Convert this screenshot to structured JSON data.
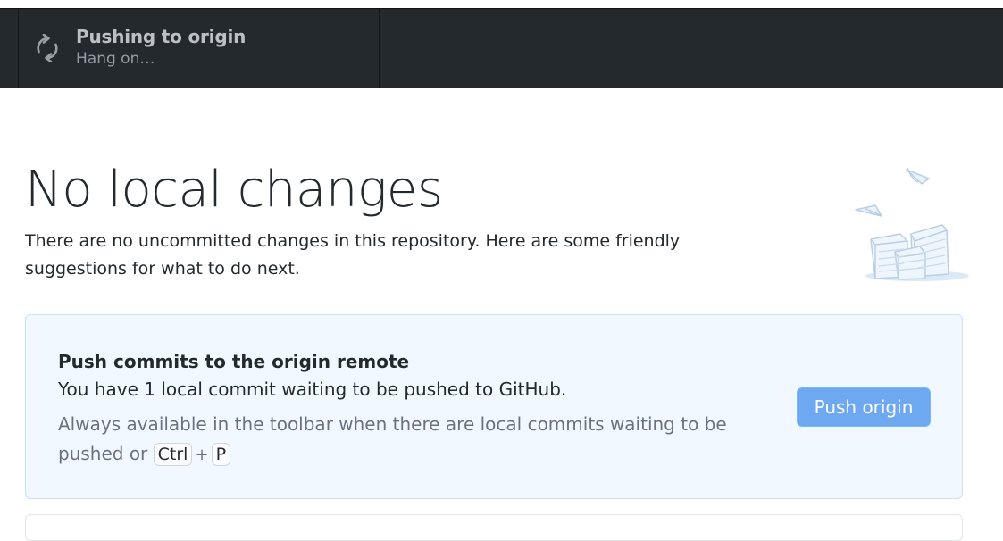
{
  "toolbar": {
    "push_button": {
      "title": "Pushing to origin",
      "subtitle": "Hang on…",
      "icon": "sync-icon"
    }
  },
  "main": {
    "heading": "No local changes",
    "description": "There are no uncommitted changes in this repository. Here are some friendly suggestions for what to do next.",
    "illustration": "empty-repo-illustration"
  },
  "suggestion": {
    "title": "Push commits to the origin remote",
    "text": "You have 1 local commit waiting to be pushed to GitHub.",
    "hint_prefix": "Always available in the toolbar when there are local commits waiting to be pushed or",
    "shortcut_key_1": "Ctrl",
    "shortcut_plus": "+",
    "shortcut_key_2": "P",
    "button_label": "Push origin"
  },
  "colors": {
    "toolbar_bg": "#24292e",
    "card_bg": "#f1f8ff",
    "card_border": "#c8e1ff",
    "button_bg": "#6ea8f0"
  }
}
